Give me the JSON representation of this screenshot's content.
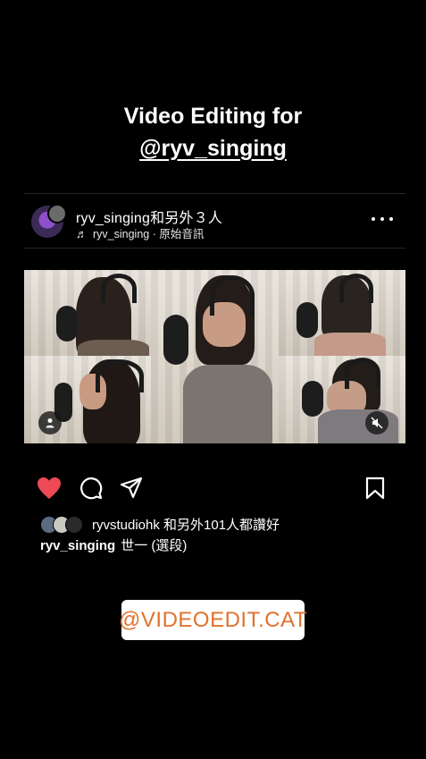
{
  "story": {
    "title_line1": "Video Editing for",
    "title_mention": "@ryv_singing"
  },
  "post": {
    "username_line": "ryv_singing和另外３人",
    "audio_note_icon": "music-note-icon",
    "audio_text": "ryv_singing · 原始音訊",
    "more_icon": "more-horizontal-icon",
    "likes_text": "ryvstudiohk 和另外101人都讚好",
    "caption_user": "ryv_singing",
    "caption_text": "世一 (選段)",
    "colors": {
      "heart": "#ed4956",
      "background": "#000000",
      "divider": "#262626"
    }
  },
  "badge": {
    "text": "@VIDEOEDIT.CAT",
    "color": "#e1722b"
  }
}
